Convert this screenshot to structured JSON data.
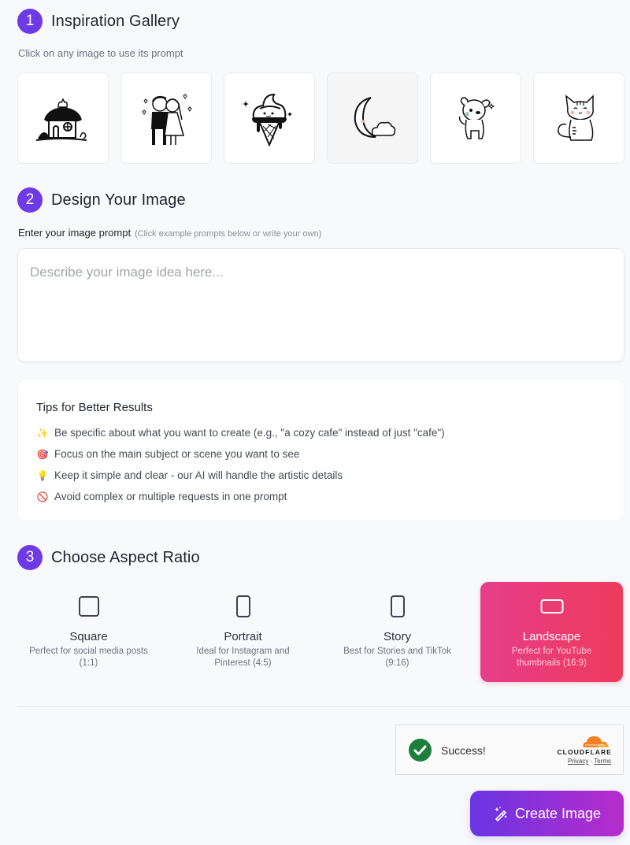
{
  "steps": [
    {
      "number": "1",
      "title": "Inspiration Gallery"
    },
    {
      "number": "2",
      "title": "Design Your Image"
    },
    {
      "number": "3",
      "title": "Choose Aspect Ratio"
    }
  ],
  "gallery": {
    "subtitle": "Click on any image to use its prompt",
    "items": [
      {
        "icon": "house-with-cat-drawing"
      },
      {
        "icon": "couple-with-hearts-drawing"
      },
      {
        "icon": "ice-cream-cone-drawing"
      },
      {
        "icon": "moon-and-cloud-drawing"
      },
      {
        "icon": "puppy-drawing"
      },
      {
        "icon": "kitten-drawing"
      }
    ]
  },
  "prompt": {
    "label": "Enter your image prompt",
    "hint": "(Click example prompts below or write your own)",
    "value": "",
    "placeholder": "Describe your image idea here..."
  },
  "tips": {
    "title": "Tips for Better Results",
    "items": [
      {
        "emoji": "✨",
        "text": "Be specific about what you want to create (e.g., \"a cozy cafe\" instead of just \"cafe\")"
      },
      {
        "emoji": "🎯",
        "text": "Focus on the main subject or scene you want to see"
      },
      {
        "emoji": "💡",
        "text": "Keep it simple and clear - our AI will handle the artistic details"
      },
      {
        "emoji": "🚫",
        "text": "Avoid complex or multiple requests in one prompt"
      }
    ]
  },
  "aspect_ratios": {
    "selected": "Landscape",
    "options": [
      {
        "name": "Square",
        "desc": "Perfect for social media posts (1:1)",
        "icon": "square-icon"
      },
      {
        "name": "Portrait",
        "desc": "Ideal for Instagram and Pinterest (4:5)",
        "icon": "portrait-icon"
      },
      {
        "name": "Story",
        "desc": "Best for Stories and TikTok (9:16)",
        "icon": "story-icon"
      },
      {
        "name": "Landscape",
        "desc": "Perfect for YouTube thumbnails (16:9)",
        "icon": "landscape-icon"
      }
    ]
  },
  "captcha": {
    "status": "Success!",
    "brand": "CLOUDFLARE",
    "privacy": "Privacy",
    "separator": "·",
    "terms": "Terms"
  },
  "create_button": {
    "label": "Create Image"
  },
  "colors": {
    "accent_purple": "#6d3ae6",
    "selected_gradient_start": "#e63e8a",
    "selected_gradient_end": "#ee3a5b",
    "button_gradient_start": "#6a34e4",
    "button_gradient_end": "#b72ccb",
    "success_green": "#1c7f3c",
    "cloudflare_orange": "#f38020"
  }
}
